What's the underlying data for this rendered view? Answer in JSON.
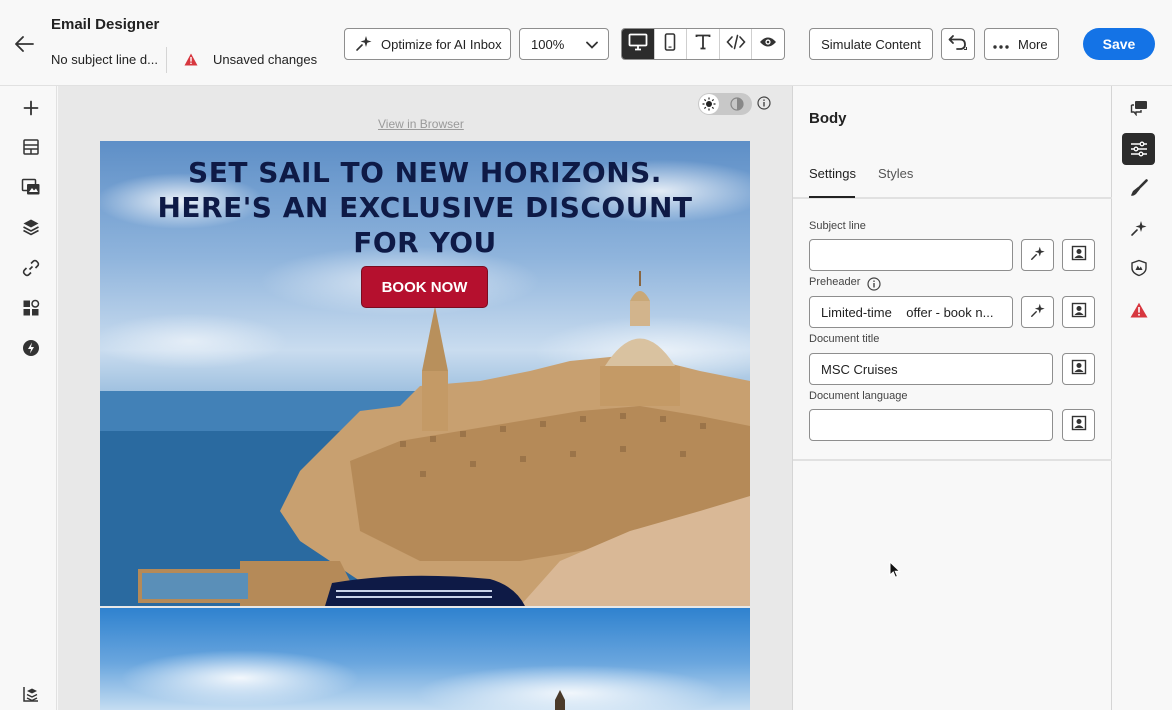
{
  "header": {
    "title": "Email Designer",
    "subject_status": "No subject line d...",
    "unsaved": "Unsaved changes",
    "optimize_label": "Optimize for AI Inbox",
    "zoom_value": "100%",
    "simulate_label": "Simulate Content",
    "more_label": "More",
    "save_label": "Save"
  },
  "canvas": {
    "view_in_browser": "View in Browser",
    "headline": [
      "SET SAIL TO NEW HORIZONS.",
      "HERE'S AN EXCLUSIVE DISCOUNT",
      "FOR YOU"
    ],
    "cta_label": "BOOK NOW"
  },
  "panel": {
    "title": "Body",
    "tabs": [
      "Settings",
      "Styles"
    ],
    "fields": {
      "subject": {
        "label": "Subject line",
        "value": ""
      },
      "preheader": {
        "label": "Preheader",
        "value": "Limited-time    offer - book n..."
      },
      "document_title": {
        "label": "Document title",
        "value": "MSC Cruises"
      },
      "document_language": {
        "label": "Document language",
        "value": ""
      }
    }
  },
  "colors": {
    "accent": "#1473e6",
    "cta": "#b5102e",
    "headline": "#0e1a46",
    "warning": "#d7373f"
  },
  "icons": {
    "left_rail": [
      "plus-icon",
      "structure-icon",
      "media-icon",
      "layers-icon",
      "link-icon",
      "fragments-icon",
      "lightning-icon",
      "toolbar-icon"
    ],
    "right_rail": [
      "comments-icon",
      "settings-sliders-icon",
      "brush-icon",
      "ai-sparkle-icon",
      "validation-icon",
      "warning-icon"
    ]
  }
}
